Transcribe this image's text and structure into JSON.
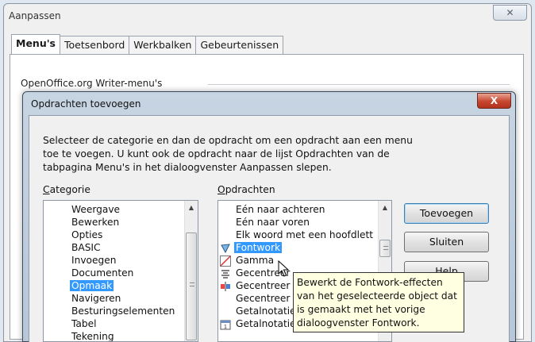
{
  "outer_window": {
    "title": "Aanpassen",
    "close_glyph": "✕",
    "tabs": [
      "Menu's",
      "Toetsenbord",
      "Werkbalken",
      "Gebeurtenissen"
    ],
    "group_label": "OpenOffice.org Writer-menu's"
  },
  "dialog": {
    "title": "Opdrachten toevoegen",
    "close_glyph": "X",
    "description": "Selecteer de categorie en dan de opdracht om een opdracht aan een menu toe te voegen. U kunt ook de opdracht naar de lijst Opdrachten van de tabpagina Menu's in het dialoogvenster Aanpassen slepen.",
    "category_label_first": "C",
    "category_label_rest": "ategorie",
    "commands_label_first": "O",
    "commands_label_rest": "pdrachten",
    "categories": [
      {
        "label": "Weergave"
      },
      {
        "label": "Bewerken"
      },
      {
        "label": "Opties"
      },
      {
        "label": "BASIC"
      },
      {
        "label": "Invoegen"
      },
      {
        "label": "Documenten"
      },
      {
        "label": "Opmaak",
        "selected": true
      },
      {
        "label": "Navigeren"
      },
      {
        "label": "Besturingselementen"
      },
      {
        "label": "Tabel"
      },
      {
        "label": "Tekening"
      }
    ],
    "commands": [
      {
        "label": "Eén naar achteren",
        "icon": "none"
      },
      {
        "label": "Eén naar voren",
        "icon": "none"
      },
      {
        "label": "Elk woord met een hoofdlett",
        "icon": "none"
      },
      {
        "label": "Fontwork",
        "icon": "fontwork-icon",
        "selected": true
      },
      {
        "label": "Gamma",
        "icon": "gamma-icon"
      },
      {
        "label": "Gecentreer",
        "icon": "align-center-icon"
      },
      {
        "label": "Gecentreer",
        "icon": "center-object-icon"
      },
      {
        "label": "Gecentreer",
        "icon": "none"
      },
      {
        "label": "Getalnotatie",
        "icon": "none"
      },
      {
        "label": "Getalnotatie: datum",
        "icon": "date-format-icon"
      }
    ],
    "buttons": {
      "add": "Toevoegen",
      "close": "Sluiten",
      "help": "Help"
    },
    "tooltip": "Bewerkt de Fontwork-effecten van het geselecteerde object dat is gemaakt met het vorige dialoogvenster Fontwork."
  }
}
